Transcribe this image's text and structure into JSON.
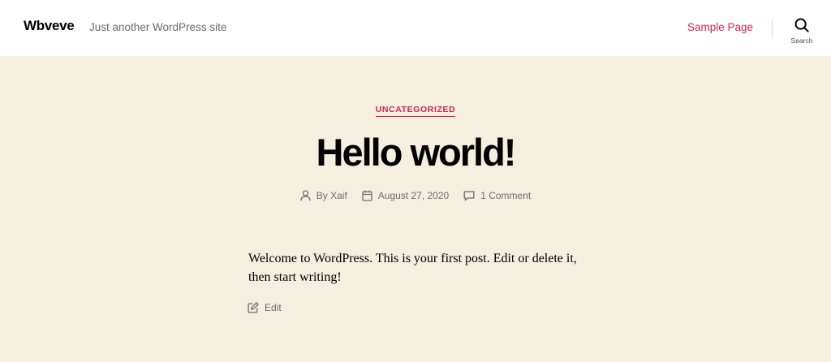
{
  "header": {
    "site_title": "Wbveve",
    "site_description": "Just another WordPress site",
    "nav_items": [
      "Sample Page"
    ],
    "search_label": "Search"
  },
  "post": {
    "category": "UNCATEGORIZED",
    "title": "Hello world!",
    "meta": {
      "author": "By Xaif",
      "date": "August 27, 2020",
      "comments": "1 Comment"
    },
    "content": "Welcome to WordPress. This is your first post. Edit or delete it, then start writing!",
    "edit_label": "Edit"
  },
  "colors": {
    "accent": "#cd2653",
    "background": "#f5efe0",
    "header_background": "#ffffff",
    "secondary_text": "#6d6d6d"
  },
  "icons": {
    "search": "search-icon",
    "author": "user-icon",
    "date": "calendar-icon",
    "comments": "comment-icon",
    "edit": "edit-icon"
  }
}
